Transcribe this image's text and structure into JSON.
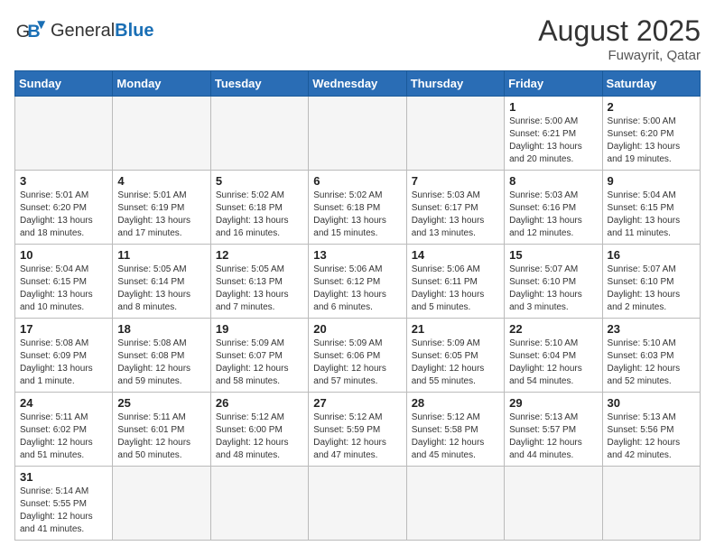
{
  "header": {
    "logo_text_normal": "General",
    "logo_text_blue": "Blue",
    "month_year": "August 2025",
    "location": "Fuwayrit, Qatar"
  },
  "days_of_week": [
    "Sunday",
    "Monday",
    "Tuesday",
    "Wednesday",
    "Thursday",
    "Friday",
    "Saturday"
  ],
  "weeks": [
    [
      {
        "day": "",
        "info": ""
      },
      {
        "day": "",
        "info": ""
      },
      {
        "day": "",
        "info": ""
      },
      {
        "day": "",
        "info": ""
      },
      {
        "day": "",
        "info": ""
      },
      {
        "day": "1",
        "info": "Sunrise: 5:00 AM\nSunset: 6:21 PM\nDaylight: 13 hours and 20 minutes."
      },
      {
        "day": "2",
        "info": "Sunrise: 5:00 AM\nSunset: 6:20 PM\nDaylight: 13 hours and 19 minutes."
      }
    ],
    [
      {
        "day": "3",
        "info": "Sunrise: 5:01 AM\nSunset: 6:20 PM\nDaylight: 13 hours and 18 minutes."
      },
      {
        "day": "4",
        "info": "Sunrise: 5:01 AM\nSunset: 6:19 PM\nDaylight: 13 hours and 17 minutes."
      },
      {
        "day": "5",
        "info": "Sunrise: 5:02 AM\nSunset: 6:18 PM\nDaylight: 13 hours and 16 minutes."
      },
      {
        "day": "6",
        "info": "Sunrise: 5:02 AM\nSunset: 6:18 PM\nDaylight: 13 hours and 15 minutes."
      },
      {
        "day": "7",
        "info": "Sunrise: 5:03 AM\nSunset: 6:17 PM\nDaylight: 13 hours and 13 minutes."
      },
      {
        "day": "8",
        "info": "Sunrise: 5:03 AM\nSunset: 6:16 PM\nDaylight: 13 hours and 12 minutes."
      },
      {
        "day": "9",
        "info": "Sunrise: 5:04 AM\nSunset: 6:15 PM\nDaylight: 13 hours and 11 minutes."
      }
    ],
    [
      {
        "day": "10",
        "info": "Sunrise: 5:04 AM\nSunset: 6:15 PM\nDaylight: 13 hours and 10 minutes."
      },
      {
        "day": "11",
        "info": "Sunrise: 5:05 AM\nSunset: 6:14 PM\nDaylight: 13 hours and 8 minutes."
      },
      {
        "day": "12",
        "info": "Sunrise: 5:05 AM\nSunset: 6:13 PM\nDaylight: 13 hours and 7 minutes."
      },
      {
        "day": "13",
        "info": "Sunrise: 5:06 AM\nSunset: 6:12 PM\nDaylight: 13 hours and 6 minutes."
      },
      {
        "day": "14",
        "info": "Sunrise: 5:06 AM\nSunset: 6:11 PM\nDaylight: 13 hours and 5 minutes."
      },
      {
        "day": "15",
        "info": "Sunrise: 5:07 AM\nSunset: 6:10 PM\nDaylight: 13 hours and 3 minutes."
      },
      {
        "day": "16",
        "info": "Sunrise: 5:07 AM\nSunset: 6:10 PM\nDaylight: 13 hours and 2 minutes."
      }
    ],
    [
      {
        "day": "17",
        "info": "Sunrise: 5:08 AM\nSunset: 6:09 PM\nDaylight: 13 hours and 1 minute."
      },
      {
        "day": "18",
        "info": "Sunrise: 5:08 AM\nSunset: 6:08 PM\nDaylight: 12 hours and 59 minutes."
      },
      {
        "day": "19",
        "info": "Sunrise: 5:09 AM\nSunset: 6:07 PM\nDaylight: 12 hours and 58 minutes."
      },
      {
        "day": "20",
        "info": "Sunrise: 5:09 AM\nSunset: 6:06 PM\nDaylight: 12 hours and 57 minutes."
      },
      {
        "day": "21",
        "info": "Sunrise: 5:09 AM\nSunset: 6:05 PM\nDaylight: 12 hours and 55 minutes."
      },
      {
        "day": "22",
        "info": "Sunrise: 5:10 AM\nSunset: 6:04 PM\nDaylight: 12 hours and 54 minutes."
      },
      {
        "day": "23",
        "info": "Sunrise: 5:10 AM\nSunset: 6:03 PM\nDaylight: 12 hours and 52 minutes."
      }
    ],
    [
      {
        "day": "24",
        "info": "Sunrise: 5:11 AM\nSunset: 6:02 PM\nDaylight: 12 hours and 51 minutes."
      },
      {
        "day": "25",
        "info": "Sunrise: 5:11 AM\nSunset: 6:01 PM\nDaylight: 12 hours and 50 minutes."
      },
      {
        "day": "26",
        "info": "Sunrise: 5:12 AM\nSunset: 6:00 PM\nDaylight: 12 hours and 48 minutes."
      },
      {
        "day": "27",
        "info": "Sunrise: 5:12 AM\nSunset: 5:59 PM\nDaylight: 12 hours and 47 minutes."
      },
      {
        "day": "28",
        "info": "Sunrise: 5:12 AM\nSunset: 5:58 PM\nDaylight: 12 hours and 45 minutes."
      },
      {
        "day": "29",
        "info": "Sunrise: 5:13 AM\nSunset: 5:57 PM\nDaylight: 12 hours and 44 minutes."
      },
      {
        "day": "30",
        "info": "Sunrise: 5:13 AM\nSunset: 5:56 PM\nDaylight: 12 hours and 42 minutes."
      }
    ],
    [
      {
        "day": "31",
        "info": "Sunrise: 5:14 AM\nSunset: 5:55 PM\nDaylight: 12 hours and 41 minutes."
      },
      {
        "day": "",
        "info": ""
      },
      {
        "day": "",
        "info": ""
      },
      {
        "day": "",
        "info": ""
      },
      {
        "day": "",
        "info": ""
      },
      {
        "day": "",
        "info": ""
      },
      {
        "day": "",
        "info": ""
      }
    ]
  ]
}
